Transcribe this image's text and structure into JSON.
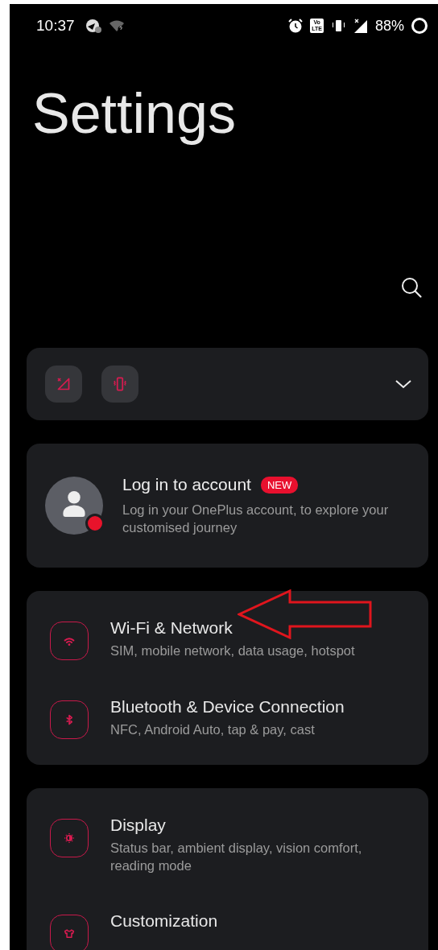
{
  "status_bar": {
    "time": "10:37",
    "network_badge": [
      "Vo",
      "LTE"
    ],
    "battery": "88%"
  },
  "title": "Settings",
  "quick_toggles": [
    {
      "kind": "mobile-data-off"
    },
    {
      "kind": "vibrate"
    }
  ],
  "account": {
    "title": "Log in to account",
    "badge": "NEW",
    "subtitle": "Log in your OnePlus account, to explore your customised journey"
  },
  "groups": [
    {
      "items": [
        {
          "kind": "wifi",
          "title": "Wi-Fi & Network",
          "subtitle": "SIM, mobile network, data usage, hotspot",
          "annotated": true
        },
        {
          "kind": "bluetooth",
          "title": "Bluetooth & Device Connection",
          "subtitle": "NFC, Android Auto, tap & pay, cast",
          "annotated": false
        }
      ]
    },
    {
      "items": [
        {
          "kind": "display",
          "title": "Display",
          "subtitle": "Status bar, ambient display, vision comfort, reading mode",
          "annotated": false
        },
        {
          "kind": "customization",
          "title": "Customization",
          "annotated": false
        }
      ]
    }
  ]
}
